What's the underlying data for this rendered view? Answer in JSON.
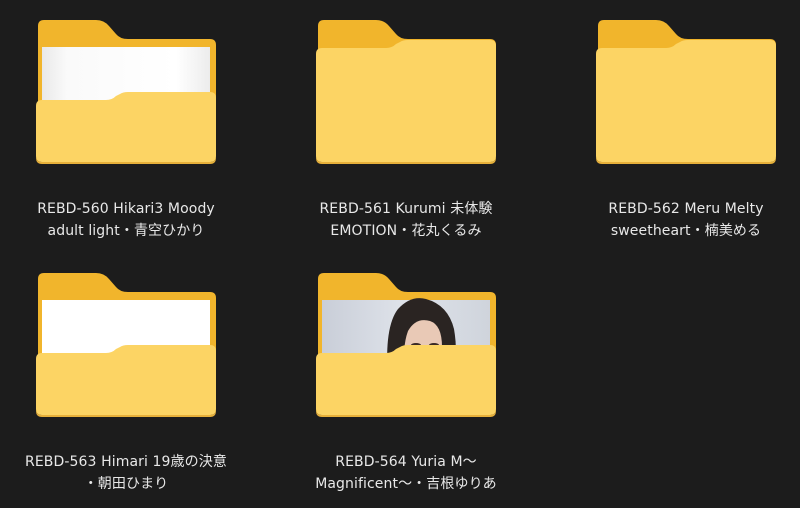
{
  "folders": [
    {
      "name_line1": "REBD-560 Hikari3 Moody",
      "name_line2": "adult light・青空ひかり",
      "thumbnail": "white-photo",
      "icon": "folder-with-preview-icon"
    },
    {
      "name_line1": "REBD-561 Kurumi 未体験",
      "name_line2": "EMOTION・花丸くるみ",
      "thumbnail": "none",
      "icon": "folder-icon"
    },
    {
      "name_line1": "REBD-562 Meru Melty",
      "name_line2": "sweetheart・楠美める",
      "thumbnail": "none",
      "icon": "folder-icon"
    },
    {
      "name_line1": "REBD-563 Himari 19歳の決意",
      "name_line2": "・朝田ひまり",
      "thumbnail": "white-photo",
      "icon": "folder-with-preview-icon"
    },
    {
      "name_line1": "REBD-564 Yuria M～",
      "name_line2": "Magnificent～・吉根ゆりあ",
      "thumbnail": "portrait-photo",
      "icon": "folder-with-preview-icon"
    }
  ],
  "colors": {
    "background": "#1c1c1c",
    "folder_back": "#f1b52c",
    "folder_front": "#fcd464",
    "folder_front_edge": "#f3c14a",
    "label_text": "#e8e8e8"
  }
}
